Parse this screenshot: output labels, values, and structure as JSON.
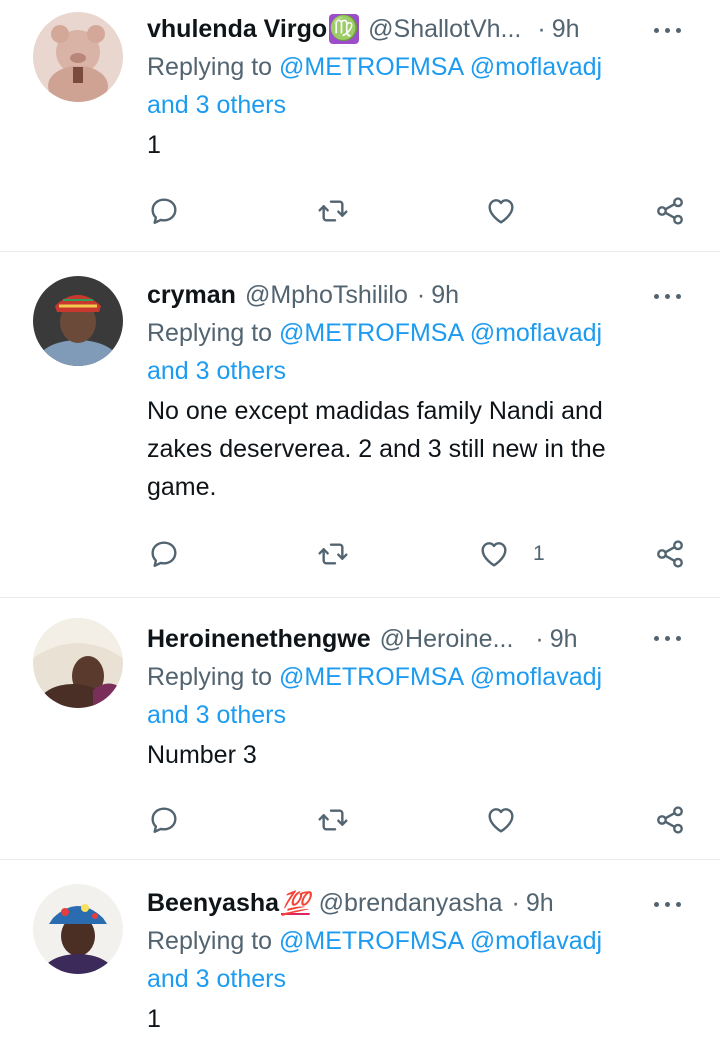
{
  "tweets": [
    {
      "name": "vhulenda Virgo",
      "name_emoji": "♍",
      "handle": "@ShallotVh...",
      "sep": "·",
      "time": "9h",
      "replying_prefix": "Replying to ",
      "mention1": "@METROFMSA",
      "mention2": "@moflavadj",
      "others": "and 3 others",
      "body": "1",
      "like_count": ""
    },
    {
      "name": "cryman",
      "handle": "@MphoTshililo",
      "sep": "·",
      "time": "9h",
      "replying_prefix": "Replying to ",
      "mention1": "@METROFMSA",
      "mention2": "@moflavadj",
      "others": "and 3 others",
      "body_lines": [
        "No one except madidas family Nandi and",
        "zakes deserverea. 2 and 3 still new in the",
        "game."
      ],
      "like_count": "1"
    },
    {
      "name": "Heroinenethengwe",
      "handle": "@Heroine...",
      "sep": "·",
      "time": "9h",
      "replying_prefix": "Replying to ",
      "mention1": "@METROFMSA",
      "mention2": "@moflavadj",
      "others": "and 3 others",
      "body": "Number 3",
      "like_count": ""
    },
    {
      "name": "Beenyasha",
      "name_emoji": "💯",
      "handle": "@brendanyasha",
      "sep": "·",
      "time": "9h",
      "replying_prefix": "Replying to ",
      "mention1": "@METROFMSA",
      "mention2": "@moflavadj",
      "others": "and 3 others",
      "body": "1"
    }
  ],
  "icons": {
    "reply": "reply-icon",
    "retweet": "retweet-icon",
    "like": "heart-icon",
    "share": "share-icon",
    "more": "more-options-icon"
  },
  "colors": {
    "link": "#1d9bf0",
    "muted": "#536471",
    "text": "#0f1419"
  }
}
